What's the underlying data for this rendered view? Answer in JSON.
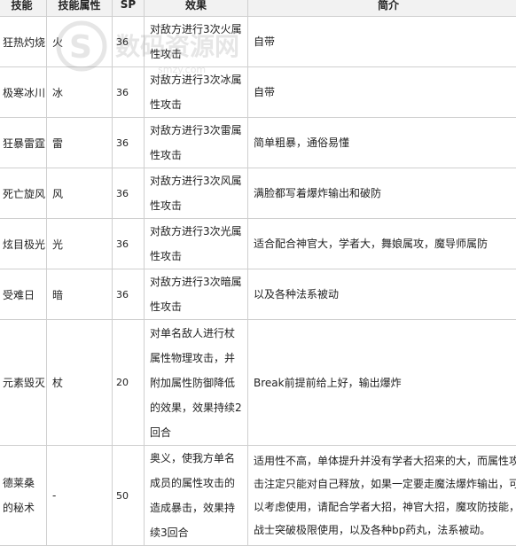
{
  "headers": [
    "技能",
    "技能属性",
    "SP",
    "效果",
    "简介"
  ],
  "rows": [
    {
      "name": "狂热灼烧",
      "attr": "火",
      "sp": "36",
      "effect": "对敌方进行3次火属性攻击",
      "desc": "自带"
    },
    {
      "name": "极寒冰川",
      "attr": "冰",
      "sp": "36",
      "effect": "对敌方进行3次冰属性攻击",
      "desc": "自带"
    },
    {
      "name": "狂暴雷霆",
      "attr": "雷",
      "sp": "36",
      "effect": "对敌方进行3次雷属性攻击",
      "desc": "简单粗暴，通俗易懂"
    },
    {
      "name": "死亡旋风",
      "attr": "风",
      "sp": "36",
      "effect": "对敌方进行3次风属性攻击",
      "desc": "满脸都写着爆炸输出和破防"
    },
    {
      "name": "炫目极光",
      "attr": "光",
      "sp": "36",
      "effect": "对敌方进行3次光属性攻击",
      "desc": "适合配合神官大，学者大，舞娘属攻，魔导师属防"
    },
    {
      "name": "受难日",
      "attr": "暗",
      "sp": "36",
      "effect": "对敌方进行3次暗属性攻击",
      "desc": "以及各种法系被动"
    },
    {
      "name": "元素毁灭",
      "attr": "杖",
      "sp": "20",
      "effect": "对单名敌人进行杖属性物理攻击，并附加属性防御降低的效果，效果持续2回合",
      "desc": "Break前提前给上好，输出爆炸"
    },
    {
      "name": "德莱桑的秘术",
      "attr": "-",
      "sp": "50",
      "effect": "奥义，使我方单名成员的属性攻击的造成暴击，效果持续3回合",
      "desc": "适用性不高，单体提升并没有学者大招来的大，而属性攻击注定只能对自己释放，如果一定要走魔法爆炸输出，可以考虑使用，请配合学者大招，神官大招，魔攻防技能，战士突破极限使用，以及各种bp药丸，法系被动。"
    }
  ],
  "watermark": {
    "logo_text": "数码资源网",
    "url": "smzy.com"
  },
  "colors": {
    "border": "#cfcfcf",
    "header_bg": "#f2f2f2",
    "text": "#222222"
  }
}
